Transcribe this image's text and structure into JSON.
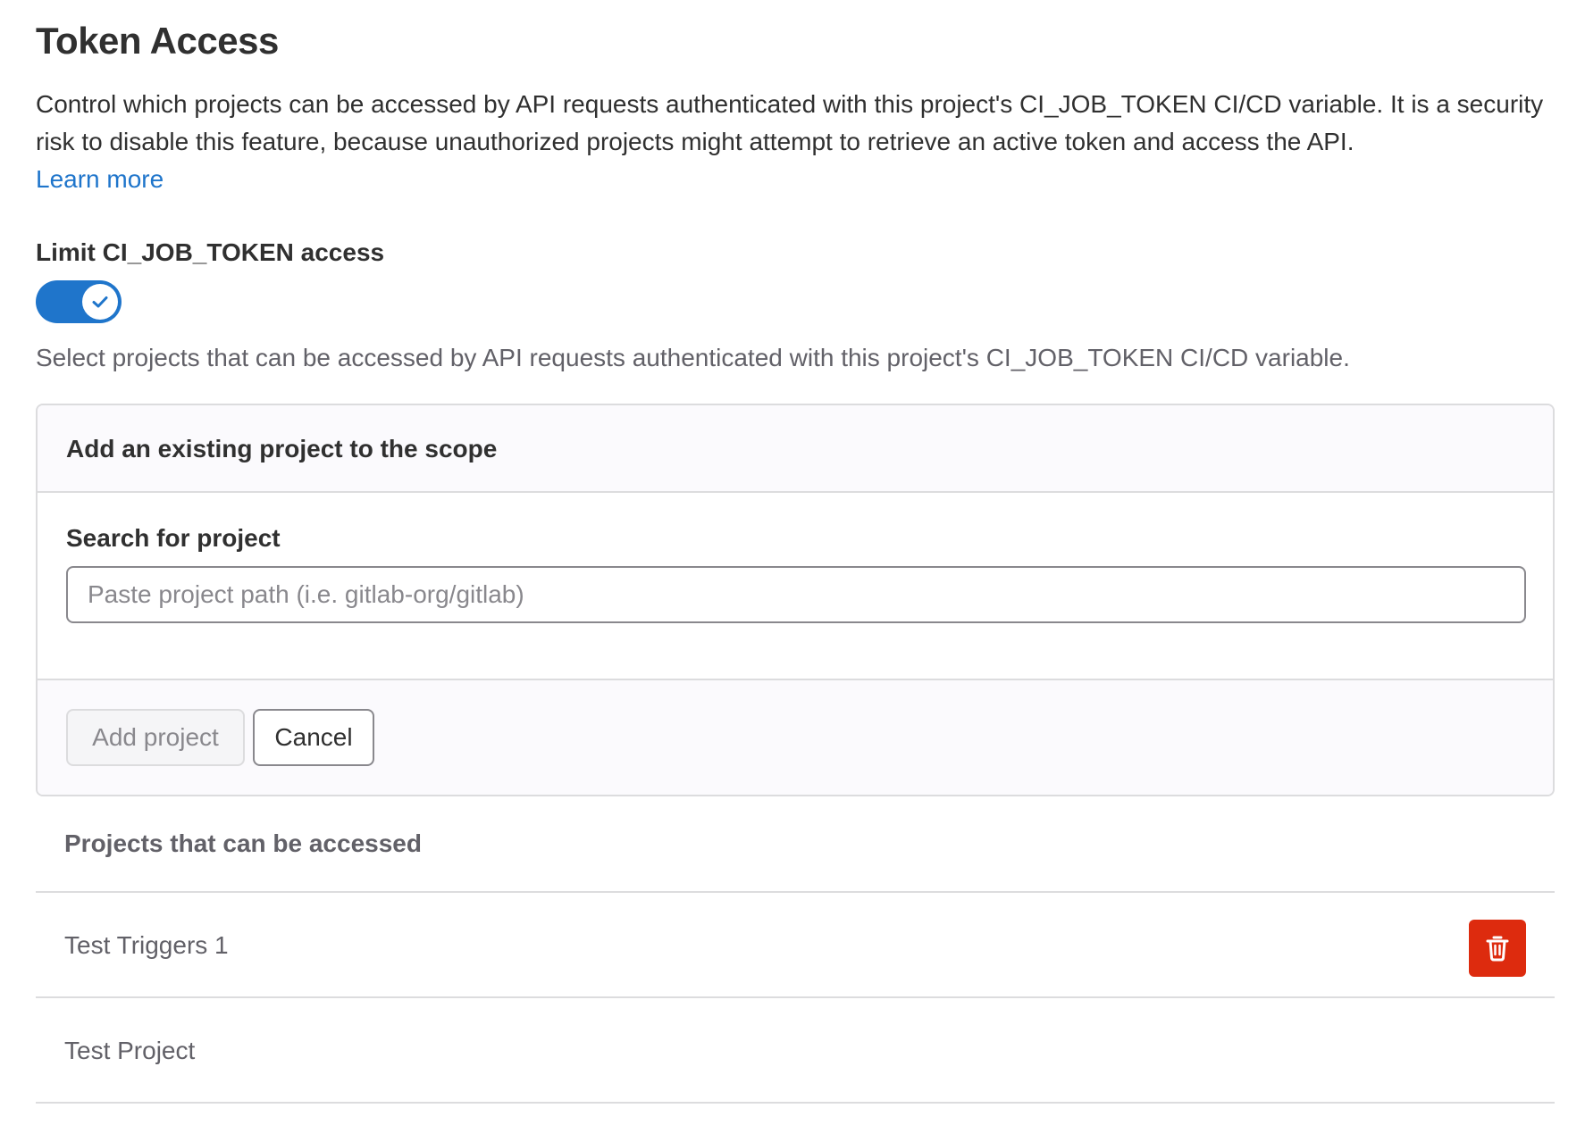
{
  "header": {
    "title": "Token Access",
    "description": "Control which projects can be accessed by API requests authenticated with this project's CI_JOB_TOKEN CI/CD variable. It is a security risk to disable this feature, because unauthorized projects might attempt to retrieve an active token and access the API.",
    "learn_more": "Learn more"
  },
  "toggle": {
    "label": "Limit CI_JOB_TOKEN access",
    "checked": true,
    "help": "Select projects that can be accessed by API requests authenticated with this project's CI_JOB_TOKEN CI/CD variable."
  },
  "add_card": {
    "title": "Add an existing project to the scope",
    "search_label": "Search for project",
    "search_placeholder": "Paste project path (i.e. gitlab-org/gitlab)",
    "search_value": "",
    "add_button": "Add project",
    "cancel_button": "Cancel"
  },
  "projects": {
    "header": "Projects that can be accessed",
    "rows": [
      {
        "name": "Test Triggers 1",
        "action_icon": "trash-icon"
      },
      {
        "name": "Test Project"
      }
    ]
  },
  "colors": {
    "accent": "#1f75cb",
    "danger": "#dd2b0e",
    "text": "#303030",
    "muted_text": "#626168",
    "border": "#dcdcde"
  }
}
